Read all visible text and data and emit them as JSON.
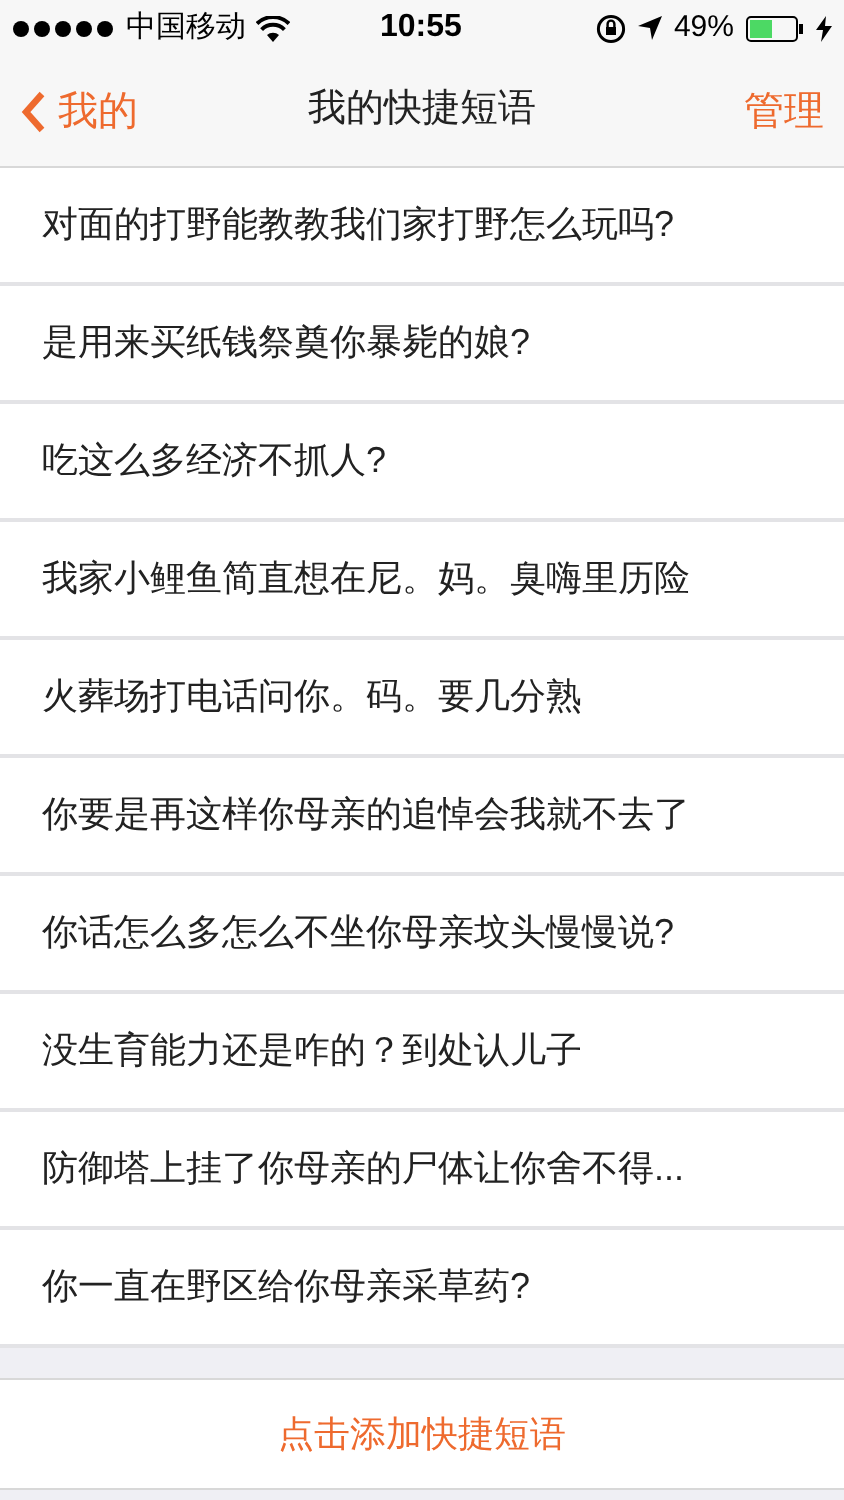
{
  "status_bar": {
    "carrier": "中国移动",
    "time": "10:55",
    "battery": "49%"
  },
  "nav": {
    "back": "我的",
    "title": "我的快捷短语",
    "action": "管理"
  },
  "phrases": [
    "对面的打野能教教我们家打野怎么玩吗?",
    "是用来买纸钱祭奠你暴毙的娘?",
    "吃这么多经济不抓人?",
    "我家小鲤鱼简直想在尼。妈。臭嗨里历险",
    "火葬场打电话问你。码。要几分熟",
    "你要是再这样你母亲的追悼会我就不去了",
    "你话怎么多怎么不坐你母亲坟头慢慢说?",
    "没生育能力还是咋的？到处认儿子",
    "防御塔上挂了你母亲的尸体让你舍不得...",
    "你一直在野区给你母亲采草药?"
  ],
  "add_button": "点击添加快捷短语"
}
